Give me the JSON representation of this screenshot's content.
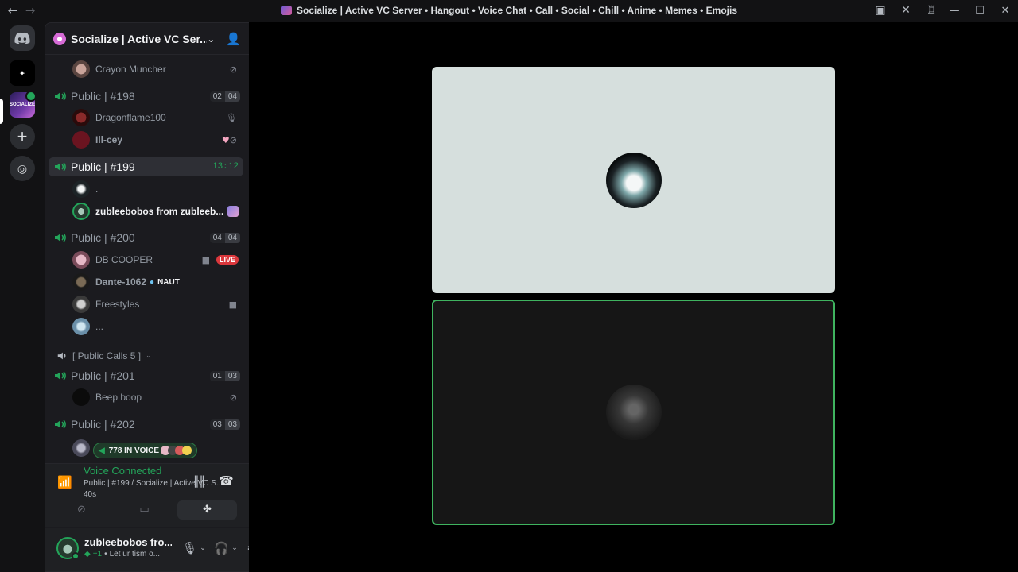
{
  "window": {
    "title": "Socialize | Active VC Server • Hangout • Voice Chat • Call • Social • Chill • Anime • Memes • Emojis"
  },
  "guilds": [
    {
      "name": "Direct Messages",
      "icon": "discord-logo-icon"
    },
    {
      "name": "Craft server",
      "icon": "server-craft-icon"
    },
    {
      "name": "Socialize",
      "icon": "server-socialize-icon",
      "label": "SOCIALIZE",
      "selected": true
    },
    {
      "name": "Add a Server",
      "icon": "plus-icon"
    },
    {
      "name": "Discover",
      "icon": "compass-icon"
    }
  ],
  "server": {
    "name": "Socialize | Active VC Ser..."
  },
  "channels": {
    "top_user": {
      "name": "Crayon Muncher",
      "status_icon": "deafened-icon"
    },
    "c198": {
      "name": "Public | #198",
      "count": "02",
      "limit": "04",
      "users": [
        {
          "name": "Dragonflame100",
          "status_icon": "muted-icon"
        },
        {
          "name": "Ill-cey",
          "badge": "♥",
          "status_icon": "deafened-icon"
        }
      ]
    },
    "c199": {
      "name": "Public | #199",
      "timer": "13:12",
      "users": [
        {
          "name": "."
        },
        {
          "name": "zubleebobos from zubleeb...",
          "bold": true
        }
      ]
    },
    "c200": {
      "name": "Public | #200",
      "count": "04",
      "limit": "04",
      "users": [
        {
          "name": "DB COOPER",
          "live": "LIVE"
        },
        {
          "name": "Dante-1062",
          "tag": "NAUT"
        },
        {
          "name": "Freestyles"
        },
        {
          "name": "..."
        }
      ]
    },
    "category": {
      "name": "[ Public Calls 5 ]"
    },
    "c201": {
      "name": "Public | #201",
      "count": "01",
      "limit": "03",
      "users": [
        {
          "name": "Beep boop",
          "status_icon": "deafened-icon"
        }
      ]
    },
    "c202": {
      "name": "Public | #202",
      "count": "03",
      "limit": "03"
    },
    "in_voice": "778 IN VOICE"
  },
  "rtc": {
    "status": "Voice Connected",
    "detail": "Public | #199 / Socialize | Active VC S...",
    "elapsed": "40s"
  },
  "me": {
    "name": "zubleebobos fro...",
    "plus": "+1",
    "status": "Let ur tism o..."
  },
  "colors": {
    "accent_green": "#23a55a",
    "live_red": "#da373c",
    "speaking_border": "#3fb35f"
  }
}
